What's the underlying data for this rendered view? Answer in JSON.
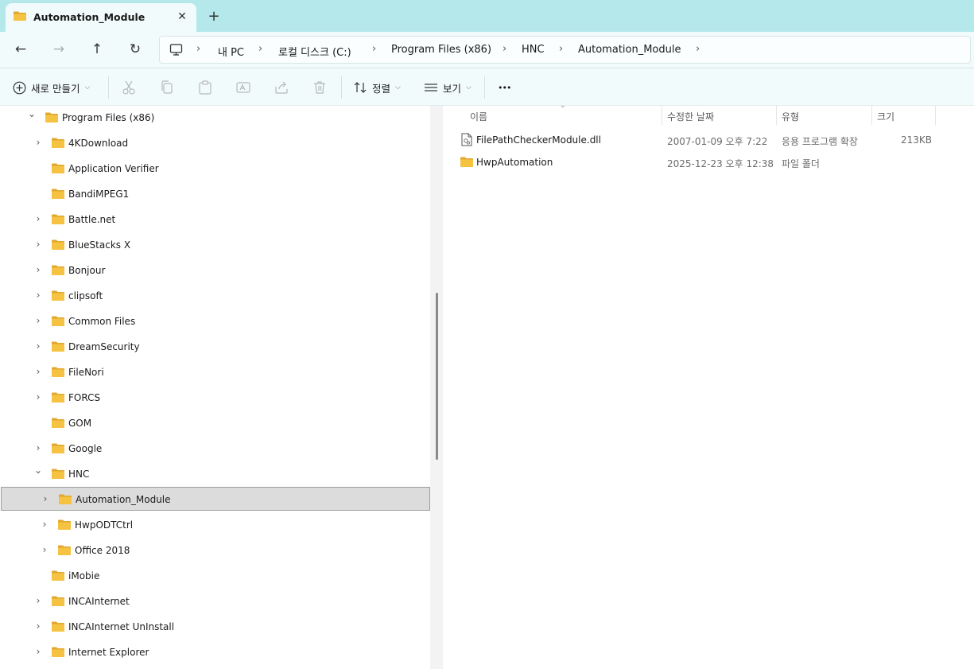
{
  "window": {
    "tab_title": "Automation_Module",
    "close_glyph": "✕",
    "new_tab_glyph": "+"
  },
  "nav": {
    "back_glyph": "←",
    "forward_glyph": "→",
    "up_glyph": "↑",
    "refresh_glyph": "↻",
    "separator": "›",
    "breadcrumbs": [
      "내 PC",
      "로컬 디스크 (C:)",
      "Program Files (x86)",
      "HNC",
      "Automation_Module"
    ]
  },
  "toolbar": {
    "new_label": "새로 만들기",
    "sort_label": "정렬",
    "view_label": "보기",
    "more_glyph": "•••",
    "chevron": "⌵"
  },
  "sidebar": {
    "expand_glyph": "›",
    "collapse_glyph": "⌄",
    "items": [
      {
        "label": "Program Files (x86)",
        "level": 0,
        "state": "expanded"
      },
      {
        "label": "4KDownload",
        "level": 1,
        "state": "collapsed"
      },
      {
        "label": "Application Verifier",
        "level": 1,
        "state": "none"
      },
      {
        "label": "BandiMPEG1",
        "level": 1,
        "state": "none"
      },
      {
        "label": "Battle.net",
        "level": 1,
        "state": "collapsed"
      },
      {
        "label": "BlueStacks X",
        "level": 1,
        "state": "collapsed"
      },
      {
        "label": "Bonjour",
        "level": 1,
        "state": "collapsed"
      },
      {
        "label": "clipsoft",
        "level": 1,
        "state": "collapsed"
      },
      {
        "label": "Common Files",
        "level": 1,
        "state": "collapsed"
      },
      {
        "label": "DreamSecurity",
        "level": 1,
        "state": "collapsed"
      },
      {
        "label": "FileNori",
        "level": 1,
        "state": "collapsed"
      },
      {
        "label": "FORCS",
        "level": 1,
        "state": "collapsed"
      },
      {
        "label": "GOM",
        "level": 1,
        "state": "none"
      },
      {
        "label": "Google",
        "level": 1,
        "state": "collapsed"
      },
      {
        "label": "HNC",
        "level": 1,
        "state": "expanded"
      },
      {
        "label": "Automation_Module",
        "level": 2,
        "state": "collapsed",
        "selected": true
      },
      {
        "label": "HwpODTCtrl",
        "level": 2,
        "state": "collapsed"
      },
      {
        "label": "Office 2018",
        "level": 2,
        "state": "collapsed"
      },
      {
        "label": "iMobie",
        "level": 1,
        "state": "none"
      },
      {
        "label": "INCAInternet",
        "level": 1,
        "state": "collapsed"
      },
      {
        "label": "INCAInternet UnInstall",
        "level": 1,
        "state": "collapsed"
      },
      {
        "label": "Internet Explorer",
        "level": 1,
        "state": "collapsed"
      }
    ]
  },
  "files": {
    "sort_caret": "⌄",
    "columns": [
      "이름",
      "수정한 날짜",
      "유형",
      "크기"
    ],
    "rows": [
      {
        "name": "FilePathCheckerModule.dll",
        "date": "2007-01-09 오후 7:22",
        "type": "응용 프로그램 확장",
        "size": "213KB",
        "icon": "dll-file-icon"
      },
      {
        "name": "HwpAutomation",
        "date": "2025-12-23 오후 12:38",
        "type": "파일 폴더",
        "size": "",
        "icon": "folder-icon"
      }
    ]
  },
  "colors": {
    "tabbar": "#b4e8ea",
    "chrome": "#f2fbfb",
    "folder": "#f5c242",
    "folder_dark": "#e0a82e",
    "selection": "#dcdcdc"
  }
}
